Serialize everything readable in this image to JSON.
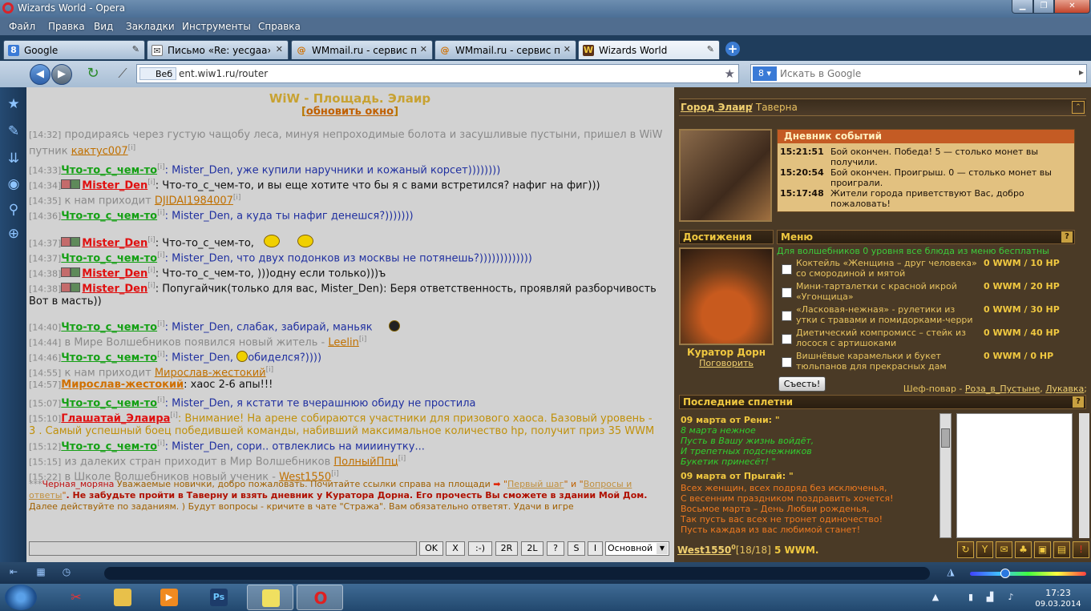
{
  "window": {
    "title": "Wizards World - Opera"
  },
  "menu": [
    "Файл",
    "Правка",
    "Вид",
    "Закладки",
    "Инструменты",
    "Справка"
  ],
  "tabs": [
    {
      "label": "Google",
      "icon": "google-icon"
    },
    {
      "label": "Письмо «Re: yecgaa» ...",
      "icon": "mail-icon"
    },
    {
      "label": "WMmail.ru - сервис п...",
      "icon": "wmmail-icon"
    },
    {
      "label": "WMmail.ru - сервис п...",
      "icon": "wmmail-icon"
    },
    {
      "label": "Wizards World",
      "icon": "wizard-icon"
    }
  ],
  "address": {
    "badge": "Веб",
    "url": "ent.wiw1.ru/router"
  },
  "search": {
    "placeholder": "Искать в Google"
  },
  "chat": {
    "title": "WiW - Площадь. Элаир",
    "refresh": "обновить окно",
    "lines": [
      {
        "ts": "[14:32]",
        "text": "продираясь через густую чащобу леса, минуя непроходимые болота и засушливые пустыни, пришел в WiW",
        "text2": "путник",
        "nick": "кактус007"
      },
      {
        "ts": "[14:33]",
        "nick": "Что-то_с_чем-то",
        "text": ": Mister_Den, уже купили наручники и кожаный корсет))))))))"
      },
      {
        "ts": "[14:34]",
        "nick": "Mister_Den",
        "text": ": Что-то_с_чем-то, и вы еще хотите что бы я с вами встретился? нафиг на фиг)))"
      },
      {
        "ts": "[14:35]",
        "text": "к нам приходит",
        "nick": "DJIDAI1984007"
      },
      {
        "ts": "[14:36]",
        "nick": "Что-то_с_чем-то",
        "text": ": Mister_Den, а куда ты нафиг денешся?)))))))"
      },
      {
        "ts": "[14:37]",
        "nick": "Mister_Den",
        "text": ": Что-то_с_чем-то,"
      },
      {
        "ts": "[14:37]",
        "nick": "Что-то_с_чем-то",
        "text": ": Mister_Den, что двух подонков из москвы не потянешь?)))))))))))))"
      },
      {
        "ts": "[14:38]",
        "nick": "Mister_Den",
        "text": ": Что-то_с_чем-то, )))одну если только)))ъ"
      },
      {
        "ts": "[14:38]",
        "nick": "Mister_Den",
        "text": ": Попугайчик(только для вас, Mister_Den): Беря ответственность, проявляй разборчивость",
        "text2": "Вот в масть))"
      },
      {
        "ts": "[14:40]",
        "nick": "Что-то_с_чем-то",
        "text": ": Mister_Den, слабак, забирай, маньяк"
      },
      {
        "ts": "[14:44]",
        "text": "в Мире Волшебников появился новый житель -",
        "nick": "Leelin"
      },
      {
        "ts": "[14:46]",
        "nick": "Что-то_с_чем-то",
        "text": ": Mister_Den,",
        "text2": "обиделся?))))"
      },
      {
        "ts": "[14:55]",
        "text": "к нам приходит",
        "nick": "Мирослав-жестокий"
      },
      {
        "ts": "[14:57]",
        "nick": "Мирослав-жестокий",
        "text": ": хаос 2-6 апы!!!"
      },
      {
        "ts": "[15:07]",
        "nick": "Что-то_с_чем-то",
        "text": ": Mister_Den, я кстати те вчерашнюю обиду не простила"
      },
      {
        "ts": "[15:10]",
        "nick": "Глашатай_Элаира",
        "text": ": Внимание! На арене собираются участники для призового хаоса. Базовый уровень -",
        "text2": "3 . Самый успешный боец победившей команды, набивший максимальное количество hp, получит приз 35 WWM"
      },
      {
        "ts": "[15:12]",
        "nick": "Что-то_с_чем-то",
        "text": ": Mister_Den, сори.. отвлеклись на мииинутку..."
      },
      {
        "ts": "[15:15]",
        "text": "из далеких стран приходит в Мир Волшебников",
        "nick": "ПолныйПпц"
      },
      {
        "ts": "[15:22]",
        "text": "в Школе Волшебников новый ученик -",
        "nick": "West1550"
      }
    ],
    "sup": "[i]",
    "notice": {
      "prefix": "***",
      "author": "Черная_моряна",
      "text1": "Уважаемые новички, добро пожаловать. Почитайте ссылки справа на площади",
      "link1": "Первый шаг",
      "and": "и",
      "link2": "Вопросы и ответы",
      "text2": ". Не забудьте пройти в Таверну и взять дневник у Куратора Дорна. Его прочесть Вы сможете в здании Мой Дом.",
      "text3": "Далее действуйте по заданиям. ) Будут вопросы - кричите в чате \"Стража\". Вам обязательно ответят. Удачи в игре"
    },
    "buttons": [
      "OK",
      "X",
      ":-)",
      "2R",
      "2L",
      "?",
      "S",
      "I"
    ],
    "channel": "Основной"
  },
  "game": {
    "location_city": "Город Элаир",
    "location_rest": "/ Таверна",
    "diary_title": "Дневник событий",
    "diary": [
      {
        "time": "15:21:51",
        "text": "Бой окончен. Победа! 5 — столько монет вы получили."
      },
      {
        "time": "15:20:54",
        "text": "Бой окончен. Проигрыш. 0 — столько монет вы проиграли."
      },
      {
        "time": "15:17:48",
        "text": "Жители города приветствуют Вас, добро пожаловать!"
      }
    ],
    "achievements_title": "Достижения",
    "menu_title": "Меню",
    "menu_free": "Для волшебников 0 уровня все блюда из меню бесплатны",
    "menu_items": [
      {
        "name": "Коктейль «Женщина – друг человека» со смородиной и мятой",
        "price": "0 WWM / 10 HP"
      },
      {
        "name": "Мини-тарталетки с красной икрой «Угонщица»",
        "price": "0 WWM / 20 HP"
      },
      {
        "name": "«Ласковая-нежная» - рулетики из утки с травами и помидорками-черри",
        "price": "0 WWM / 30 HP"
      },
      {
        "name": "Диетический компромисс – стейк из лосося с артишоками",
        "price": "0 WWM / 40 HP"
      },
      {
        "name": "Вишнёвые карамельки и букет тюльпанов для прекрасных дам",
        "price": "0 WWM / 0 HP"
      }
    ],
    "eat_button": "Съесть!",
    "chef_label": "Шеф-повар -",
    "chef1": "Роза_в_Пустыне",
    "chef2": "Лукавка",
    "curator_name": "Куратор Дорн",
    "curator_talk": "Поговорить",
    "gossip_title": "Последние сплетни",
    "gossip": [
      {
        "kind": "head",
        "text": "09 марта от Рени: \""
      },
      {
        "kind": "green",
        "text": "8 марта нежное"
      },
      {
        "kind": "green",
        "text": "Пусть в Вашу жизнь войдёт,"
      },
      {
        "kind": "green",
        "text": "И трепетных подснежников"
      },
      {
        "kind": "green",
        "text": "Букетик принесёт! \""
      },
      {
        "kind": "head",
        "text": "09 марта от Прыгай: \""
      },
      {
        "kind": "orange",
        "text": "Всех женщин, всех подряд без исключенья,"
      },
      {
        "kind": "orange",
        "text": "С весенним праздником поздравить хочется!"
      },
      {
        "kind": "orange",
        "text": "Восьмое марта – День Любви рожденья,"
      },
      {
        "kind": "orange",
        "text": "Так пусть вас всех не тронет одиночество!"
      },
      {
        "kind": "orange",
        "text": "Пусть каждая из вас любимой станет!"
      }
    ],
    "status_nick": "West1550",
    "status_level": "0",
    "status_hp": "[18/18]",
    "status_money": "5 WWM.",
    "help": "?"
  },
  "taskbar": {
    "time": "17:23",
    "date": "09.03.2014"
  }
}
